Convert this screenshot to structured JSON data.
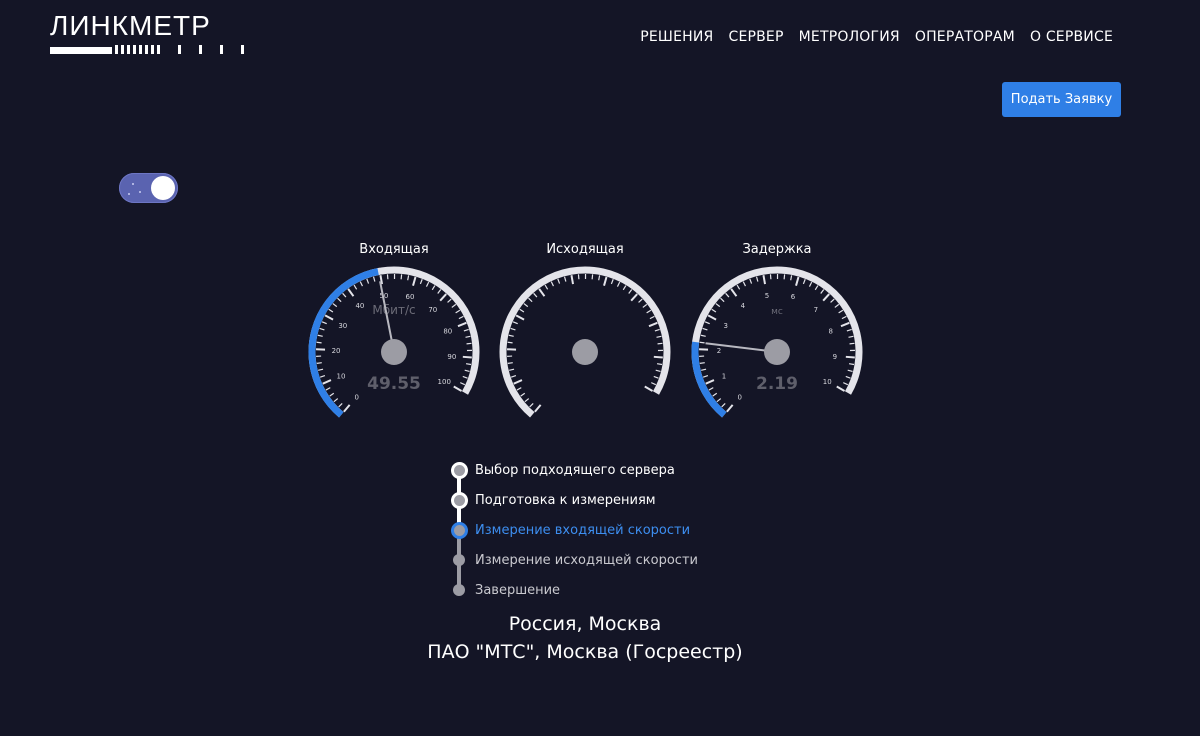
{
  "header": {
    "logo_text": "ЛИНКМЕТР",
    "nav": [
      "РЕШЕНИЯ",
      "СЕРВЕР",
      "МЕТРОЛОГИЯ",
      "ОПЕРАТОРАМ",
      "О СЕРВИСЕ"
    ],
    "apply_label": "Подать Заявку"
  },
  "theme_toggle": {
    "state": "on"
  },
  "colors": {
    "background": "#141526",
    "accent": "#2f7fe6",
    "track": "#e4e4ea",
    "hub": "#9c9ca4"
  },
  "gauges": [
    {
      "title": "Входящая",
      "unit": "Мбит/с",
      "min": 0,
      "max": 100,
      "ticks": [
        "0",
        "10",
        "20",
        "30",
        "40",
        "50",
        "60",
        "70",
        "80",
        "90",
        "100"
      ],
      "value": 49.55,
      "value_text": "49.55"
    },
    {
      "title": "Исходящая",
      "unit": "",
      "min": 0,
      "max": 100,
      "ticks": [],
      "value": null,
      "value_text": ""
    },
    {
      "title": "Задержка",
      "unit": "мс",
      "min": 0,
      "max": 10,
      "ticks": [
        "0",
        "1",
        "2",
        "3",
        "4",
        "5",
        "6",
        "7",
        "8",
        "9",
        "10"
      ],
      "value": 2.19,
      "value_text": "2.19"
    }
  ],
  "steps": [
    {
      "label": "Выбор подходящего сервера",
      "status": "done"
    },
    {
      "label": "Подготовка к измерениям",
      "status": "done"
    },
    {
      "label": "Измерение входящей скорости",
      "status": "active"
    },
    {
      "label": "Измерение исходящей скорости",
      "status": "pending"
    },
    {
      "label": "Завершение",
      "status": "pending"
    }
  ],
  "location": {
    "city": "Россия, Москва",
    "provider": "ПАО \"МТС\", Москва (Госреестр)"
  }
}
